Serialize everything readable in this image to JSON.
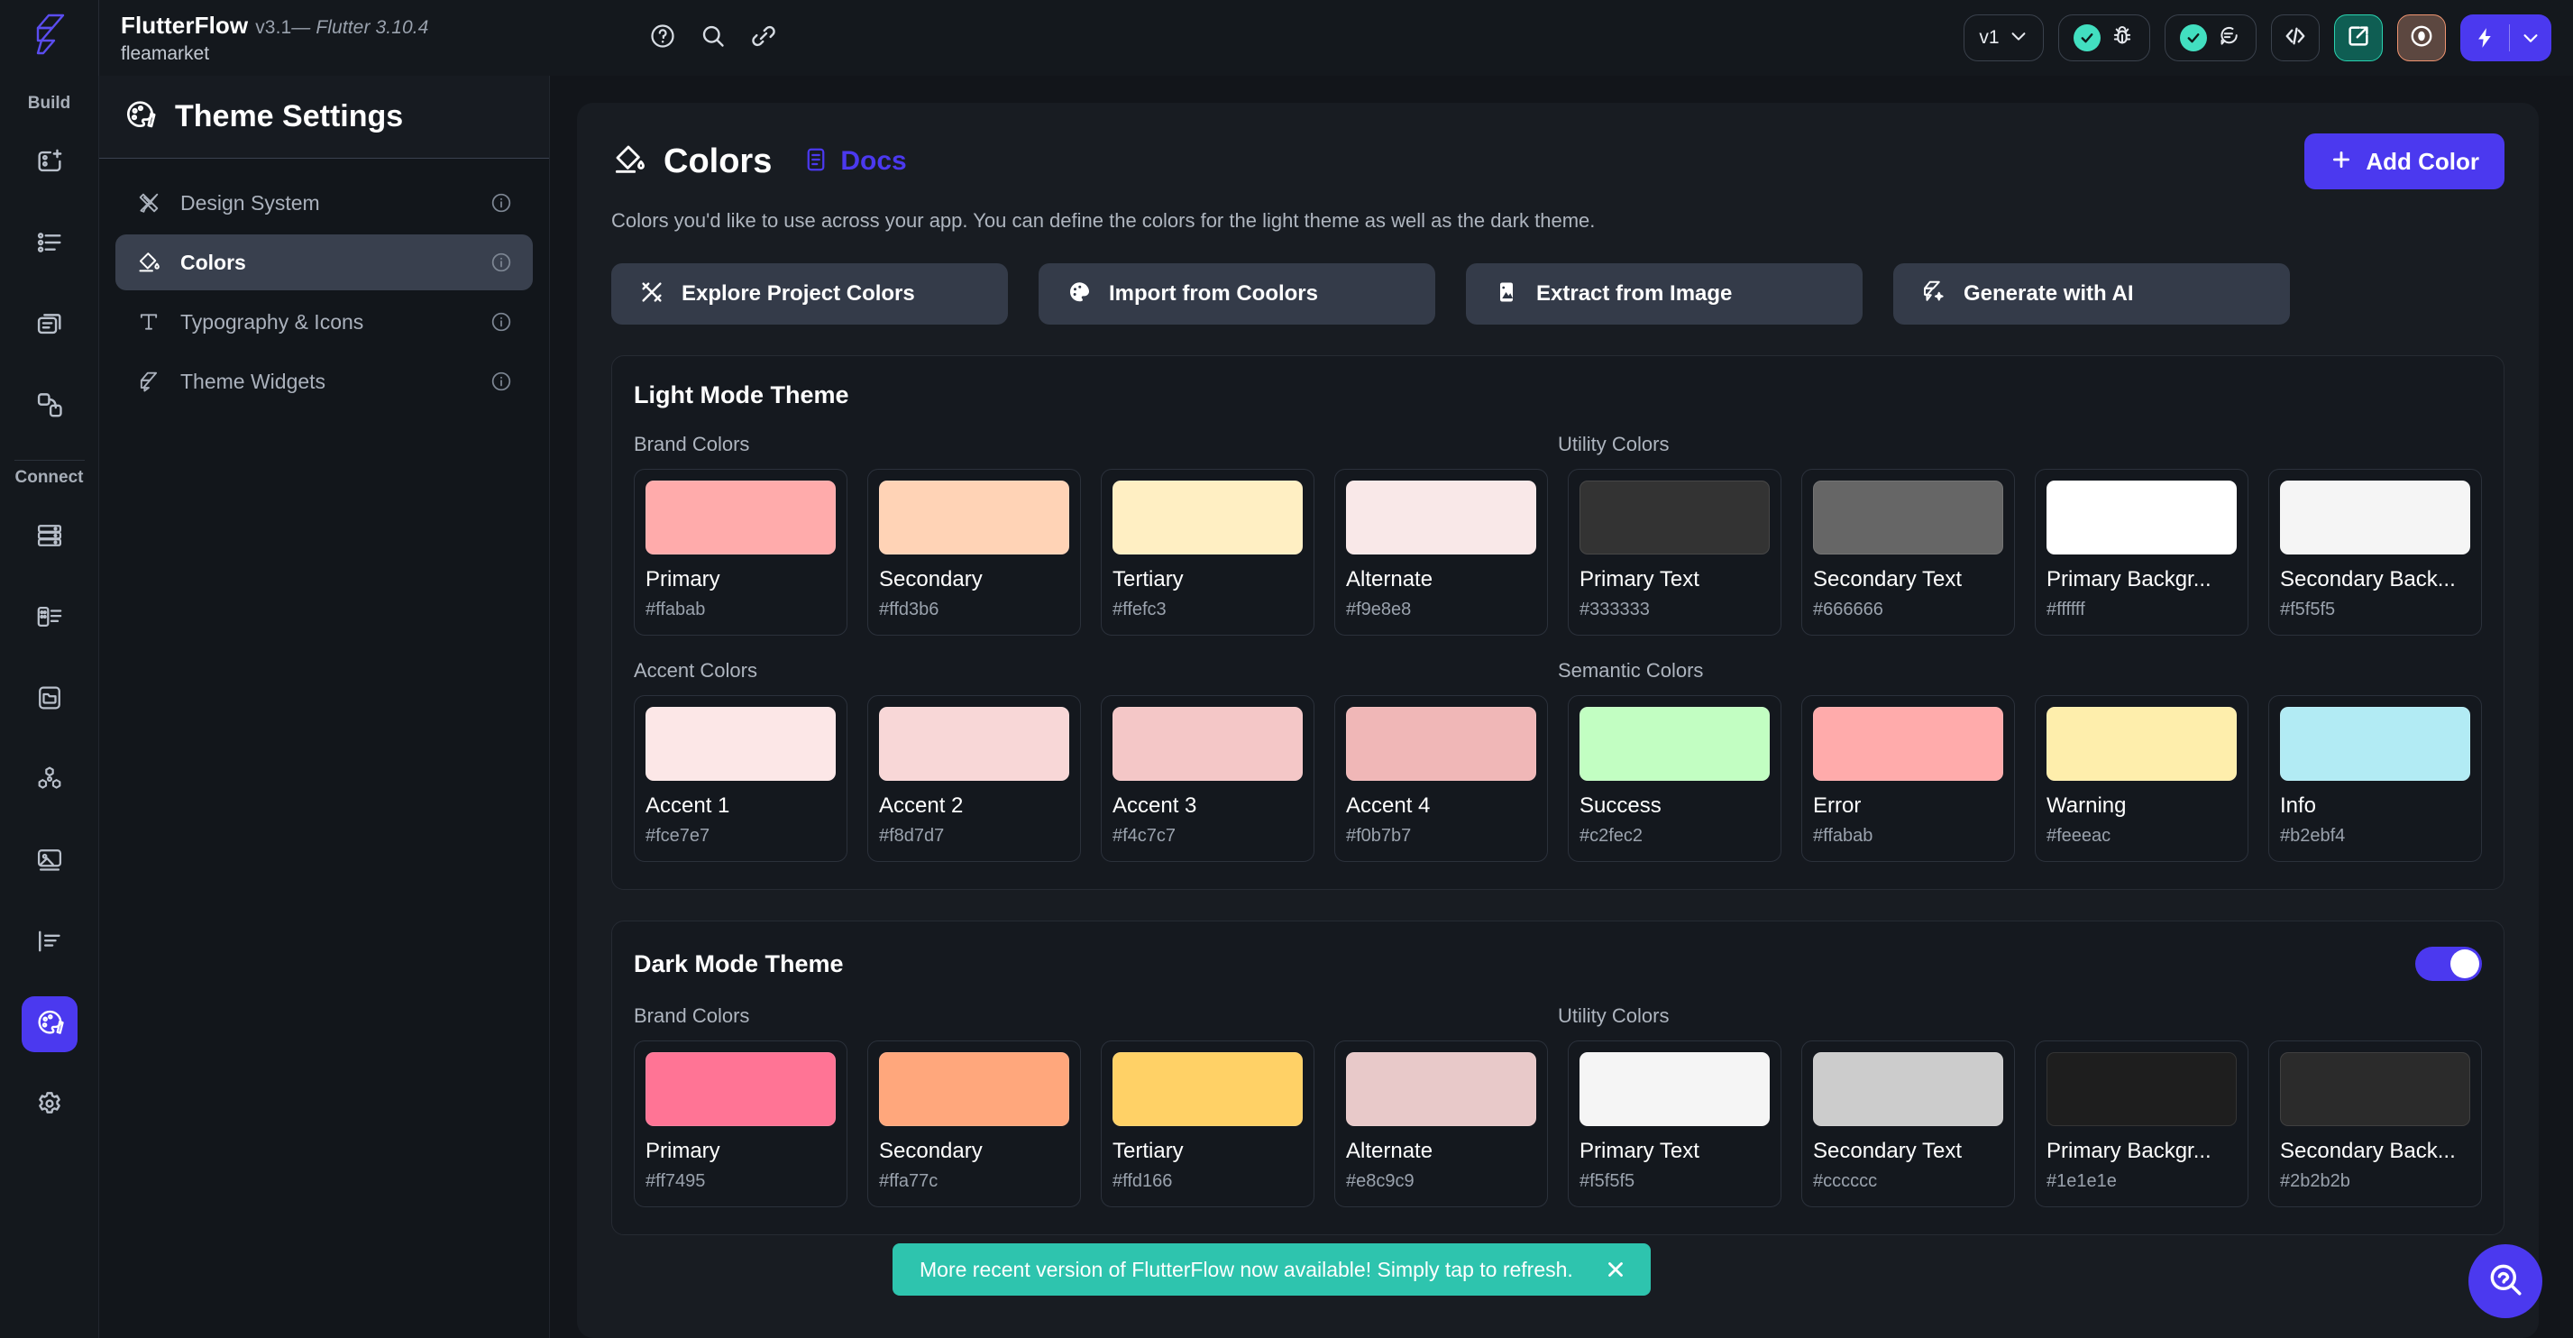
{
  "topbar": {
    "app_name": "FlutterFlow",
    "version": "v3.1",
    "flutter_version": "— Flutter 3.10.4",
    "project_name": "fleamarket",
    "help_icon": "question-circle-icon",
    "search_icon": "search-icon",
    "link_icon": "link-icon",
    "branch_label": "v1",
    "branch_chevron_icon": "chevron-down-icon",
    "debug_icon": "bug-icon",
    "comments_icon": "comment-icon",
    "code_icon": "code-brackets-icon",
    "open_external_icon": "external-link-icon",
    "preview_icon": "eye-icon",
    "run_icon": "lightning-bolt-icon",
    "run_chevron_icon": "chevron-down-icon"
  },
  "rail": {
    "build_label": "Build",
    "connect_label": "Connect",
    "items_build": [
      {
        "name": "new-page-icon"
      },
      {
        "name": "widget-tree-icon"
      },
      {
        "name": "pages-icon"
      },
      {
        "name": "navigation-icon"
      }
    ],
    "items_connect": [
      {
        "name": "database-icon"
      },
      {
        "name": "api-calls-icon"
      },
      {
        "name": "storage-icon"
      },
      {
        "name": "integrations-icon"
      },
      {
        "name": "media-assets-icon"
      },
      {
        "name": "localization-icon"
      },
      {
        "name": "theme-palette-icon"
      },
      {
        "name": "settings-gear-icon"
      }
    ]
  },
  "theme_panel": {
    "title": "Theme Settings",
    "title_icon": "palette-icon",
    "items": [
      {
        "label": "Design System",
        "icon": "ruler-pencil-icon",
        "selected": false
      },
      {
        "label": "Colors",
        "icon": "paint-bucket-icon",
        "selected": true
      },
      {
        "label": "Typography & Icons",
        "icon": "text-format-icon",
        "selected": false
      },
      {
        "label": "Theme Widgets",
        "icon": "theme-widgets-icon",
        "selected": false
      }
    ],
    "info_icon": "info-circle-icon"
  },
  "page": {
    "title": "Colors",
    "title_icon": "paint-bucket-icon",
    "docs_label": "Docs",
    "docs_icon": "docs-page-icon",
    "add_color_label": "Add Color",
    "add_color_icon": "plus-icon",
    "subtitle": "Colors you'd like to use across your app. You can define the colors for the light theme as well as the dark theme.",
    "accent_color": "#4b39ef",
    "actions": [
      {
        "label": "Explore Project Colors",
        "icon": "shuffle-colors-icon"
      },
      {
        "label": "Import from Coolors",
        "icon": "palette-icon"
      },
      {
        "label": "Extract from Image",
        "icon": "image-icon"
      },
      {
        "label": "Generate with AI",
        "icon": "ai-sparkle-icon"
      }
    ]
  },
  "light_theme": {
    "title": "Light Mode Theme",
    "group_brand_label": "Brand Colors",
    "group_utility_label": "Utility Colors",
    "group_accent_label": "Accent Colors",
    "group_semantic_label": "Semantic Colors",
    "brand": [
      {
        "name": "Primary",
        "hex": "#ffabab"
      },
      {
        "name": "Secondary",
        "hex": "#ffd3b6"
      },
      {
        "name": "Tertiary",
        "hex": "#ffefc3"
      },
      {
        "name": "Alternate",
        "hex": "#f9e8e8"
      }
    ],
    "utility": [
      {
        "name": "Primary Text",
        "hex": "#333333"
      },
      {
        "name": "Secondary Text",
        "hex": "#666666"
      },
      {
        "name": "Primary Backgr...",
        "hex": "#ffffff"
      },
      {
        "name": "Secondary Back...",
        "hex": "#f5f5f5"
      }
    ],
    "accent": [
      {
        "name": "Accent 1",
        "hex": "#fce7e7"
      },
      {
        "name": "Accent 2",
        "hex": "#f8d7d7"
      },
      {
        "name": "Accent 3",
        "hex": "#f4c7c7"
      },
      {
        "name": "Accent 4",
        "hex": "#f0b7b7"
      }
    ],
    "semantic": [
      {
        "name": "Success",
        "hex": "#c2fec2"
      },
      {
        "name": "Error",
        "hex": "#ffabab"
      },
      {
        "name": "Warning",
        "hex": "#feeeac"
      },
      {
        "name": "Info",
        "hex": "#b2ebf4"
      }
    ]
  },
  "dark_theme": {
    "title": "Dark Mode Theme",
    "toggle_on": true,
    "group_brand_label": "Brand Colors",
    "group_utility_label": "Utility Colors",
    "brand": [
      {
        "name": "Primary",
        "hex": "#ff7495"
      },
      {
        "name": "Secondary",
        "hex": "#ffa77c"
      },
      {
        "name": "Tertiary",
        "hex": "#ffd166"
      },
      {
        "name": "Alternate",
        "hex": "#e8c9c9"
      }
    ],
    "utility": [
      {
        "name": "Primary Text",
        "hex": "#f5f5f5"
      },
      {
        "name": "Secondary Text",
        "hex": "#cccccc"
      },
      {
        "name": "Primary Backgr...",
        "hex": "#1e1e1e"
      },
      {
        "name": "Secondary Back...",
        "hex": "#2b2b2b"
      }
    ]
  },
  "toast": {
    "message": "More recent version of FlutterFlow now available! Simply tap to refresh.",
    "close_icon": "close-x-icon",
    "background": "#2ec4ae"
  },
  "help_fab": {
    "icon": "help-search-icon"
  }
}
